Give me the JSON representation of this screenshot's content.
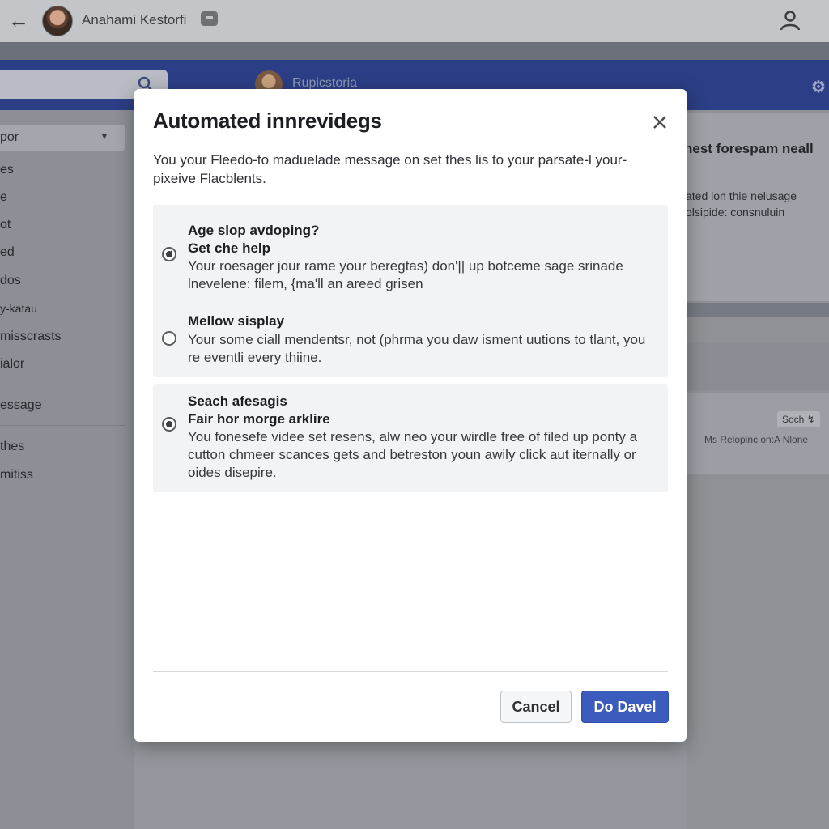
{
  "topbar": {
    "user_name": "Anahami Kestorfi"
  },
  "header": {
    "page_label": "Rupicstoria"
  },
  "sidebar": {
    "dropdown_label": "por",
    "items": [
      "es",
      "e",
      "ot",
      "ed",
      "dos",
      "y-katau",
      "misscrasts",
      "ialor",
      "essage",
      "thes",
      "mitiss"
    ]
  },
  "right_panel": {
    "title": "nest forespam neall",
    "line1": "ated lon thie nelusage",
    "line2": "olsipide: consnuluin",
    "badge": "Soch ↯",
    "small_text": "Ms Relopinc on:A Nlone"
  },
  "modal": {
    "title": "Automated innrevidegs",
    "description": "You your Fleedo-to maduelade message on set thes lis to your parsate-l your-pixeive Flacblents.",
    "options": [
      {
        "title": "Age slop avdoping?",
        "subtitle": "Get che help",
        "body": "Your roesager jour rame your beregtas) don'|| up botceme sage srinade lnevelene: filem, {ma'll an areed grisen",
        "state": "checked"
      },
      {
        "title": "Mellow sisplay",
        "subtitle": "",
        "body": "Your some ciall mendentsr, not (phrma you daw isment uutions to tlant, you re eventli every thiine.",
        "state": "unchecked"
      },
      {
        "title": "Seach afesagis",
        "subtitle": "Fair hor morge arklire",
        "body": "You fonesefe videe set resens, alw neo your wirdle free of filed up ponty a cutton chmeer scances gets and betreston youn awily click aut iternally or oides disepire.",
        "state": "selected"
      }
    ],
    "cancel_label": "Cancel",
    "confirm_label": "Do Davel"
  },
  "colors": {
    "primary_button": "#3b5bbd",
    "header_blue": "#2c3e86",
    "overlay": "#8f9196"
  }
}
